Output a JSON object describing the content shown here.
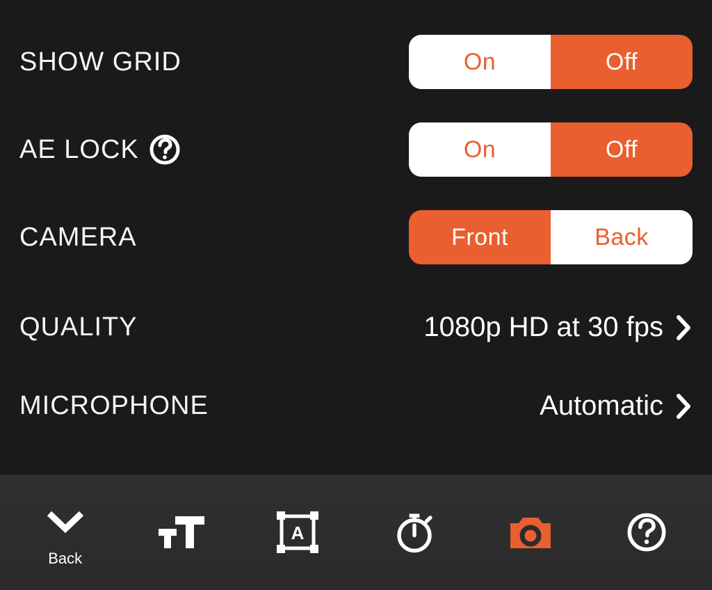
{
  "colors": {
    "accent": "#e95f2f",
    "bg": "#1a1a1a",
    "toolbar": "#2b2b2b"
  },
  "settings": {
    "show_grid": {
      "label": "SHOW GRID",
      "options": [
        "On",
        "Off"
      ],
      "selected": "On"
    },
    "ae_lock": {
      "label": "AE LOCK",
      "help_icon": "question-circle-icon",
      "options": [
        "On",
        "Off"
      ],
      "selected": "On"
    },
    "camera": {
      "label": "CAMERA",
      "options": [
        "Front",
        "Back"
      ],
      "selected": "Back"
    },
    "quality": {
      "label": "QUALITY",
      "value": "1080p HD at 30 fps"
    },
    "microphone": {
      "label": "MICROPHONE",
      "value": "Automatic"
    }
  },
  "toolbar": {
    "back_label": "Back",
    "items": [
      {
        "name": "back",
        "icon": "chevron-down-icon",
        "label": "Back"
      },
      {
        "name": "text-size",
        "icon": "text-size-icon"
      },
      {
        "name": "transform",
        "icon": "transform-box-icon"
      },
      {
        "name": "timer",
        "icon": "timer-icon"
      },
      {
        "name": "camera",
        "icon": "camera-icon",
        "active": true
      },
      {
        "name": "help",
        "icon": "question-circle-icon"
      }
    ]
  }
}
